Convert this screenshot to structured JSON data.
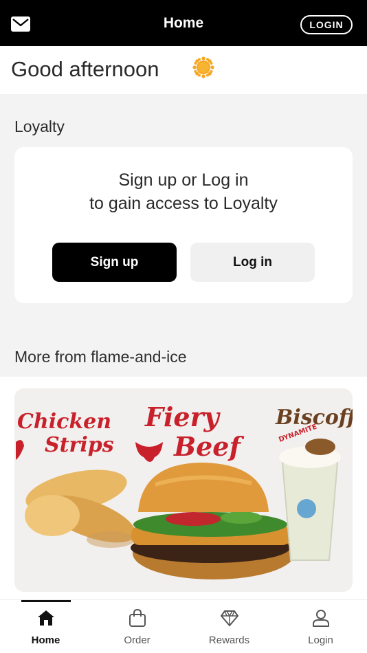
{
  "header": {
    "title": "Home",
    "login_label": "LOGIN",
    "mail_icon": "mail-icon"
  },
  "greeting": {
    "text": "Good afternoon",
    "icon": "sun-icon",
    "icon_color": "#f5a623"
  },
  "loyalty": {
    "section_title": "Loyalty",
    "message_line1": "Sign up or Log in",
    "message_line2": "to gain access to Loyalty",
    "signup_label": "Sign up",
    "login_label": "Log in"
  },
  "more": {
    "section_title": "More from flame-and-ice",
    "promo": {
      "image": "promo-banner",
      "texts": [
        "Chicken Strips",
        "Fiery Beef",
        "Biscoff",
        "DYNAMITE"
      ]
    }
  },
  "tabbar": {
    "active": "Home",
    "tabs": [
      {
        "label": "Home",
        "icon": "home-icon"
      },
      {
        "label": "Order",
        "icon": "bag-icon"
      },
      {
        "label": "Rewards",
        "icon": "diamond-icon"
      },
      {
        "label": "Login",
        "icon": "user-icon"
      }
    ]
  },
  "colors": {
    "header_bg": "#000000",
    "accent": "#000000",
    "page_bg": "#f3f3f3",
    "promo_red": "#c8212b"
  }
}
